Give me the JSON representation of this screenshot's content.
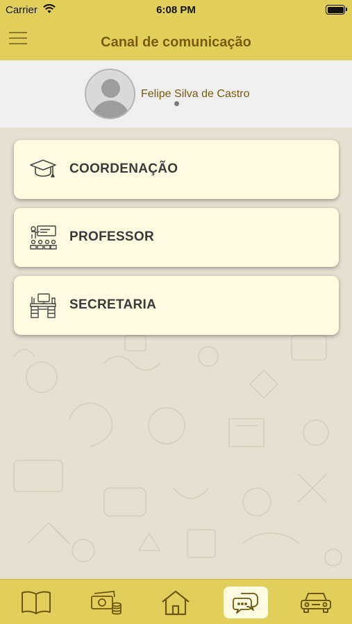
{
  "status_bar": {
    "carrier": "Carrier",
    "time": "6:08 PM"
  },
  "nav": {
    "title": "Canal de comunicação"
  },
  "profile": {
    "name": "Felipe Silva de Castro"
  },
  "menu": [
    {
      "label": "COORDENAÇÃO",
      "icon": "graduation-cap-icon"
    },
    {
      "label": "PROFESSOR",
      "icon": "teacher-class-icon"
    },
    {
      "label": "SECRETARIA",
      "icon": "desk-icon"
    }
  ],
  "tabs": [
    {
      "icon": "book-icon",
      "active": false
    },
    {
      "icon": "money-icon",
      "active": false
    },
    {
      "icon": "home-icon",
      "active": false
    },
    {
      "icon": "chat-icon",
      "active": true
    },
    {
      "icon": "car-icon",
      "active": false
    }
  ],
  "colors": {
    "accent": "#e2cf5b",
    "title": "#7a5a0e",
    "card": "#fdfbe0",
    "background": "#e6e0d2"
  }
}
